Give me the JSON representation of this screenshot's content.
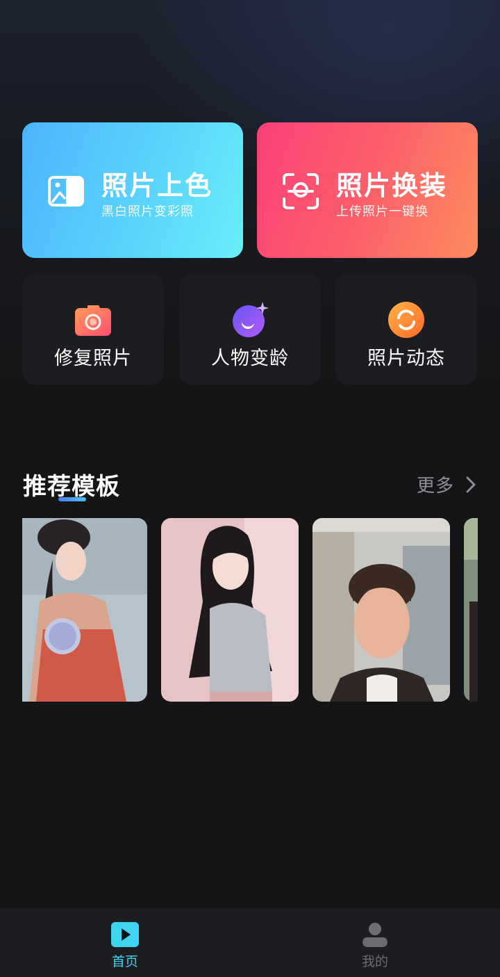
{
  "colors": {
    "background": "#151517",
    "card_dark": "#1c1d21",
    "colorize_gradient": [
      "#4db4fb",
      "#68eef7"
    ],
    "swap_gradient": [
      "#fb4078",
      "#fc8c5e"
    ],
    "accent": "#3fd4ef",
    "tab_inactive": "#6b6d73"
  },
  "feature_cards": {
    "colorize": {
      "title": "照片上色",
      "subtitle": "黑白照片变彩照",
      "icon": "photo-icon"
    },
    "swap": {
      "title": "照片换装",
      "subtitle": "上传照片一键换",
      "icon": "face-scan-icon"
    }
  },
  "tools": [
    {
      "label": "修复照片",
      "icon": "camera-icon"
    },
    {
      "label": "人物变龄",
      "icon": "moon-sparkle-icon"
    },
    {
      "label": "照片动态",
      "icon": "swirl-icon"
    }
  ],
  "recommended": {
    "title": "推荐模板",
    "more_label": "更多",
    "templates": [
      {
        "subject": "hanfu-woman-with-fan"
      },
      {
        "subject": "long-hair-woman"
      },
      {
        "subject": "curly-hair-man"
      },
      {
        "subject": "partial-card"
      }
    ]
  },
  "tabbar": {
    "home": {
      "label": "首页",
      "icon": "play-icon",
      "active": true
    },
    "mine": {
      "label": "我的",
      "icon": "person-icon",
      "active": false
    }
  }
}
